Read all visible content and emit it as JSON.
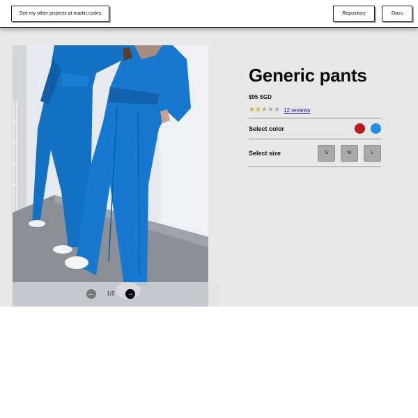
{
  "header": {
    "projects_link": "See my other projects at martin.codes",
    "repository_button": "Repository",
    "docs_button": "Docs"
  },
  "gallery": {
    "page_indicator": "1/2",
    "current_image": 1,
    "total_images": 2,
    "prev_icon": "arrow-left-icon",
    "next_icon": "arrow-right-icon"
  },
  "product": {
    "title": "Generic pants",
    "price": "$95 SGD",
    "rating": 2.5,
    "rating_max": 5,
    "reviews_link": "12 reviews",
    "select_color_label": "Select color",
    "colors": [
      {
        "name": "red",
        "hex": "#b81c1c"
      },
      {
        "name": "blue",
        "hex": "#1e90e6"
      }
    ],
    "select_size_label": "Select size",
    "sizes": [
      "S",
      "M",
      "L"
    ]
  },
  "theme": {
    "star_color": "#d8b227",
    "link_color": "#1a0dab",
    "page_background": "#e8e8e8"
  }
}
